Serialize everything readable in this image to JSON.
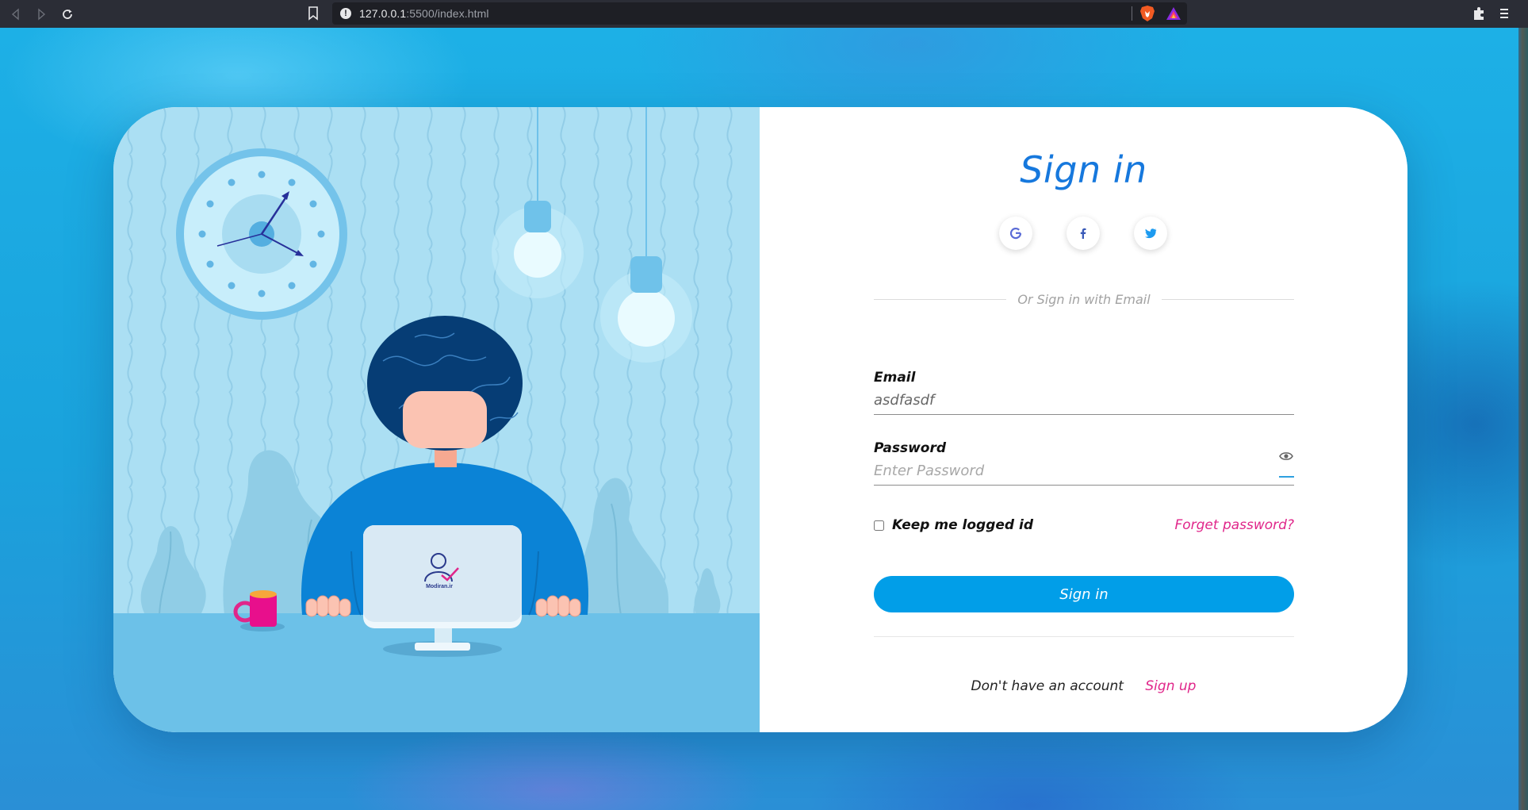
{
  "browser": {
    "url_host": "127.0.0.1",
    "url_rest": ":5500/index.html",
    "icons": [
      "back-icon",
      "forward-icon",
      "reload-icon",
      "bookmark-icon",
      "site-info-icon",
      "brave-shield-icon",
      "brave-rewards-icon",
      "extensions-icon",
      "menu-icon"
    ]
  },
  "illustration": {
    "logo_text": "Modiran.ir"
  },
  "form": {
    "title": "Sign in",
    "social": [
      "google-icon",
      "facebook-icon",
      "twitter-icon"
    ],
    "divider_text": "Or Sign in with Email",
    "email_label": "Email",
    "email_value": "asdfasdf",
    "password_label": "Password",
    "password_placeholder": "Enter Password",
    "keep_logged": "Keep me logged id",
    "forgot": "Forget password?",
    "submit": "Sign in",
    "no_account": "Don't have an account",
    "signup": "Sign up"
  },
  "colors": {
    "accent": "#1678dd",
    "button": "#019ee8",
    "link": "#e0268a",
    "illustration_bg": "#a9def2"
  }
}
